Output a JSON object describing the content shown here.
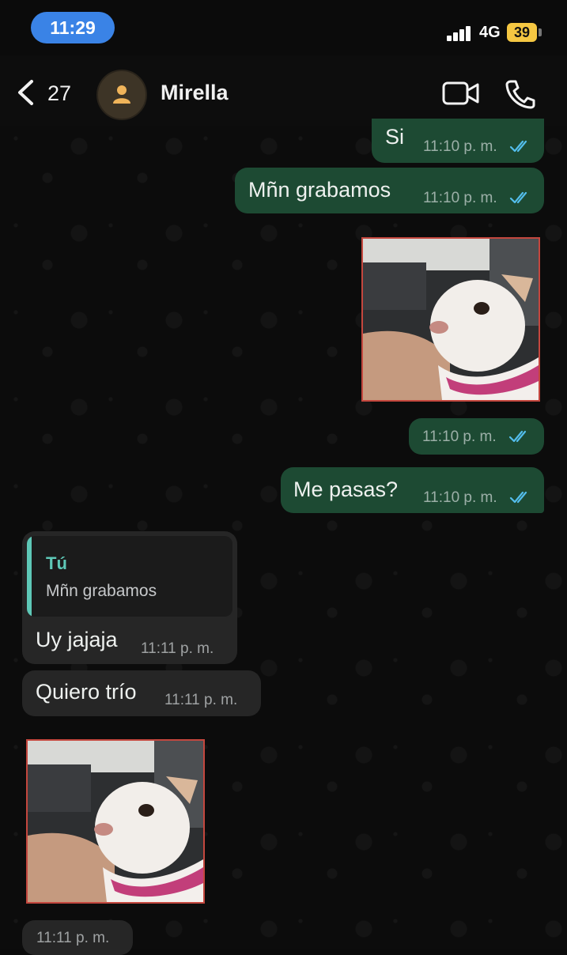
{
  "status_bar": {
    "time": "11:29",
    "network": "4G",
    "battery": "39"
  },
  "header": {
    "back_count": "27",
    "contact_name": "Mirella"
  },
  "messages": [
    {
      "direction": "out",
      "text": "Si",
      "time": "11:10 p. m.",
      "status": "read"
    },
    {
      "direction": "out",
      "text": "Mñn grabamos",
      "time": "11:10 p. m.",
      "status": "read"
    },
    {
      "direction": "out",
      "type": "image",
      "time": "11:10 p. m.",
      "status": "read"
    },
    {
      "direction": "out",
      "text": "Me pasas?",
      "time": "11:10 p. m.",
      "status": "read"
    },
    {
      "direction": "in",
      "reply_to": {
        "author": "Tú",
        "text": "Mñn grabamos"
      },
      "text": "Uy jajaja",
      "time": "11:11 p. m."
    },
    {
      "direction": "in",
      "text": "Quiero trío",
      "time": "11:11 p. m."
    },
    {
      "direction": "in",
      "type": "image",
      "time": "11:11 p. m."
    }
  ],
  "colors": {
    "outgoing_bubble": "#1d4a33",
    "incoming_bubble": "#262626",
    "read_ticks": "#53bdeb",
    "quote_accent": "#5ec8b7",
    "time_pill": "#3a83e6",
    "battery": "#f5c742"
  },
  "icons": [
    "back-chevron-icon",
    "user-avatar-icon",
    "video-call-icon",
    "phone-icon",
    "double-check-icon"
  ]
}
